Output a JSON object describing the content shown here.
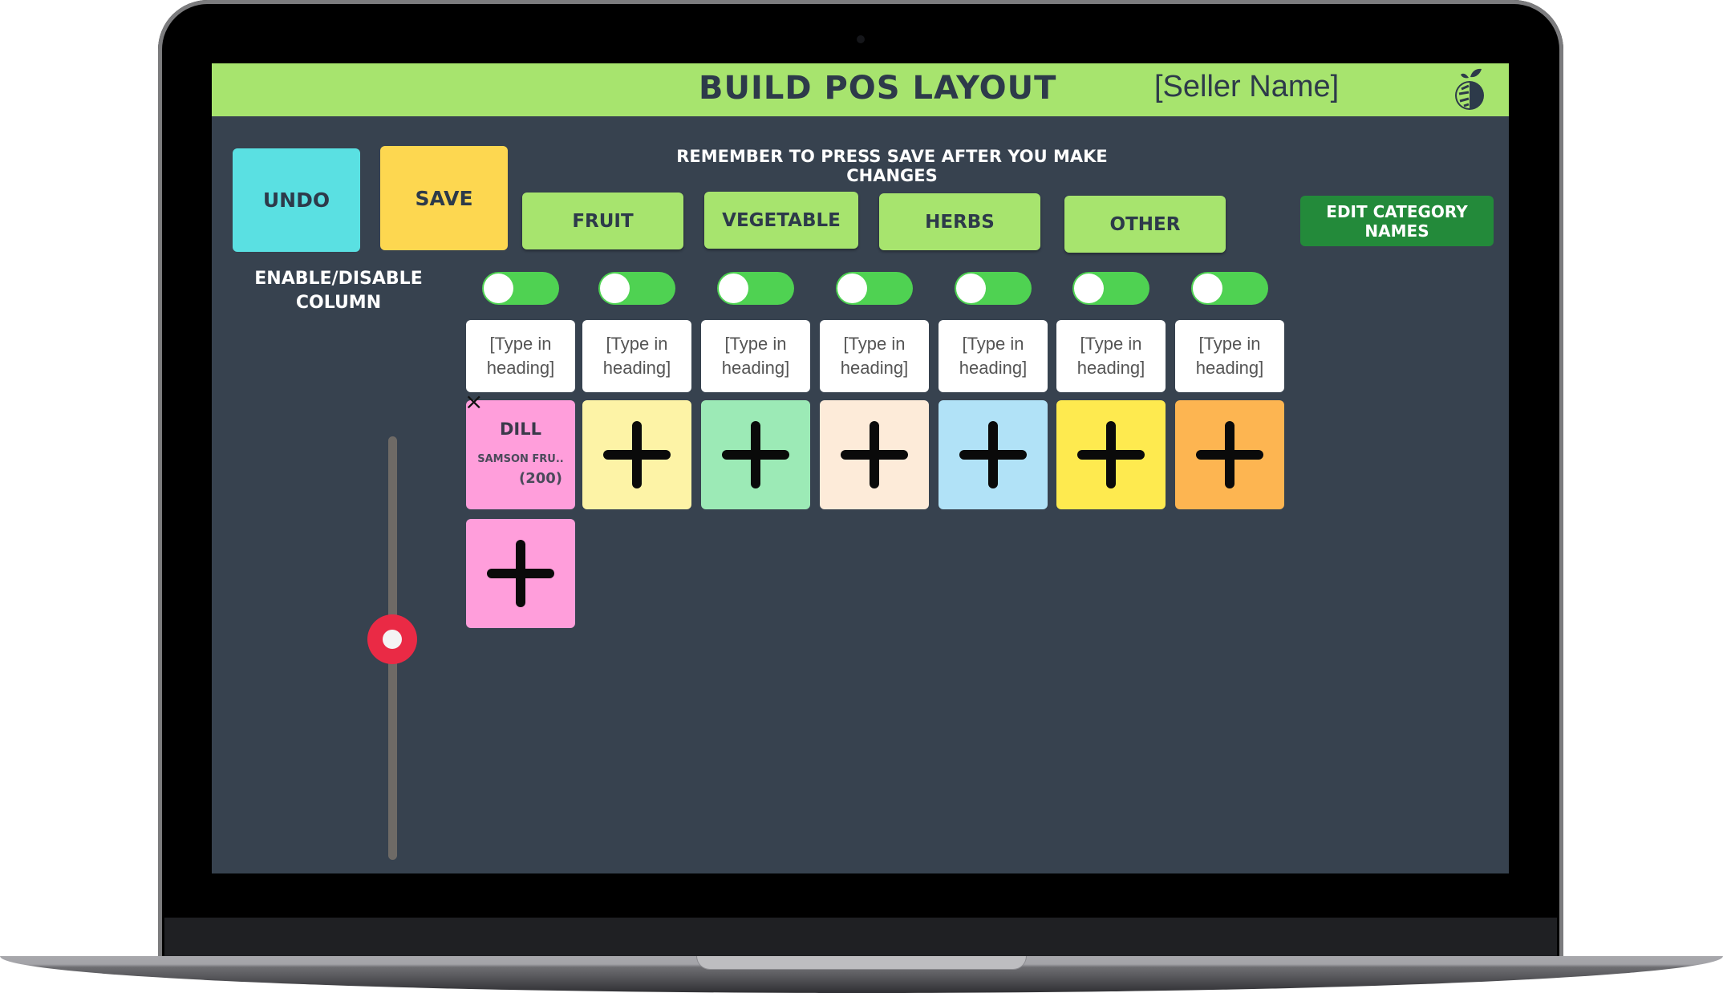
{
  "header": {
    "title": "BUILD POS LAYOUT",
    "seller_name": "[Seller Name]",
    "logo_icon": "fruit-logo-icon"
  },
  "toolbar": {
    "undo_label": "UNDO",
    "save_label": "SAVE",
    "reminder": "REMEMBER TO PRESS SAVE AFTER YOU MAKE CHANGES",
    "edit_category_label": "EDIT CATEGORY NAMES"
  },
  "categories": [
    {
      "label": "FRUIT"
    },
    {
      "label": "VEGETABLE"
    },
    {
      "label": "HERBS"
    },
    {
      "label": "OTHER"
    }
  ],
  "enable_label": "ENABLE/DISABLE COLUMN",
  "columns": [
    {
      "enabled": true,
      "heading_placeholder": "[Type in heading]",
      "color": "#ff9edb"
    },
    {
      "enabled": true,
      "heading_placeholder": "[Type in heading]",
      "color": "#fdf3a6"
    },
    {
      "enabled": true,
      "heading_placeholder": "[Type in heading]",
      "color": "#9ceab6"
    },
    {
      "enabled": true,
      "heading_placeholder": "[Type in heading]",
      "color": "#fdebd9"
    },
    {
      "enabled": true,
      "heading_placeholder": "[Type in heading]",
      "color": "#b1e2f7"
    },
    {
      "enabled": true,
      "heading_placeholder": "[Type in heading]",
      "color": "#feea4f"
    },
    {
      "enabled": true,
      "heading_placeholder": "[Type in heading]",
      "color": "#fdb551"
    }
  ],
  "items": [
    {
      "column": 1,
      "name": "DILL",
      "vendor": "SAMSON FRU..",
      "quantity": "(200)",
      "remove_icon": "close-icon"
    }
  ],
  "add_icon": "plus-icon",
  "scroll": {
    "position_fraction": 0.48
  },
  "colors": {
    "header": "#a7e46e",
    "background": "#37424f",
    "undo": "#5ae0e2",
    "save": "#fdd750",
    "category": "#a7e46e",
    "edit_category": "#238a3a",
    "toggle_on": "#4fd252",
    "slider_knob": "#ea2a45"
  }
}
